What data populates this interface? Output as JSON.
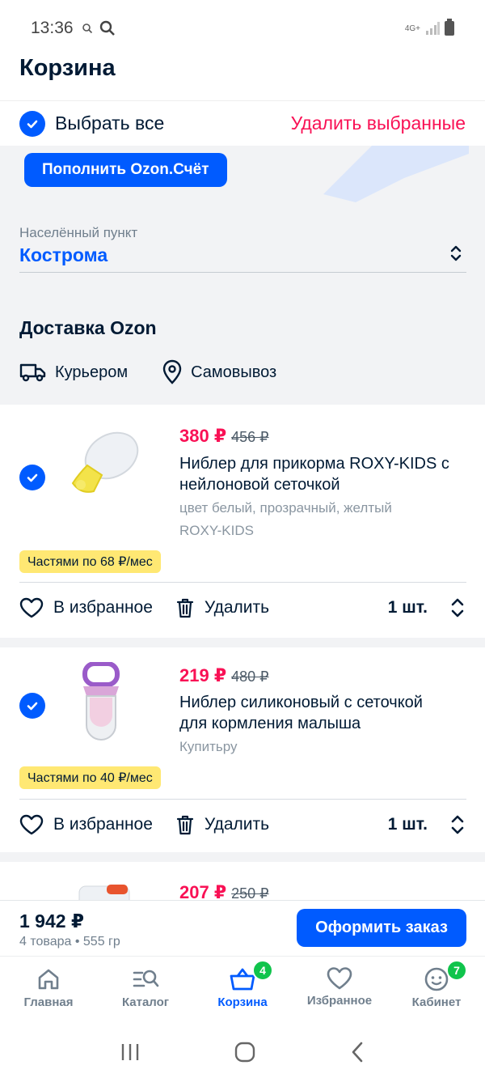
{
  "status": {
    "time": "13:36",
    "network": "4G+"
  },
  "header": {
    "title": "Корзина"
  },
  "select_bar": {
    "select_all": "Выбрать все",
    "delete_selected": "Удалить выбранные"
  },
  "promo": {
    "topup_button": "Пополнить Ozon.Счёт"
  },
  "city": {
    "label": "Населённый пункт",
    "value": "Кострома"
  },
  "delivery": {
    "title": "Доставка Ozon",
    "options": [
      "Курьером",
      "Самовывоз"
    ]
  },
  "items": [
    {
      "price": "380 ₽",
      "old_price": "456 ₽",
      "name_line1": "Ниблер для прикорма ROXY-KIDS с",
      "name_line2": "нейлоновой сеточкой",
      "color": "цвет белый, прозрачный, желтый",
      "brand": "ROXY-KIDS",
      "installment": "Частями по 68 ₽/мес",
      "favorite": "В избранное",
      "delete": "Удалить",
      "qty": "1 шт."
    },
    {
      "price": "219 ₽",
      "old_price": "480 ₽",
      "name_line1": "Ниблер силиконовый с сеточкой",
      "name_line2": "для кормления малыша",
      "brand": "Купитьру",
      "installment": "Частями по 40 ₽/мес",
      "favorite": "В избранное",
      "delete": "Удалить",
      "qty": "1 шт."
    },
    {
      "price": "207 ₽",
      "old_price": "250 ₽"
    }
  ],
  "summary": {
    "total": "1 942 ₽",
    "details": "4 товара • 555 гр",
    "checkout": "Оформить заказ"
  },
  "tabs": [
    {
      "label": "Главная"
    },
    {
      "label": "Каталог"
    },
    {
      "label": "Корзина",
      "badge": "4"
    },
    {
      "label": "Избранное"
    },
    {
      "label": "Кабинет",
      "badge": "7"
    }
  ],
  "colors": {
    "accent": "#005bff",
    "price": "#f91155",
    "badge": "#10c44c",
    "installment": "#ffe873"
  }
}
